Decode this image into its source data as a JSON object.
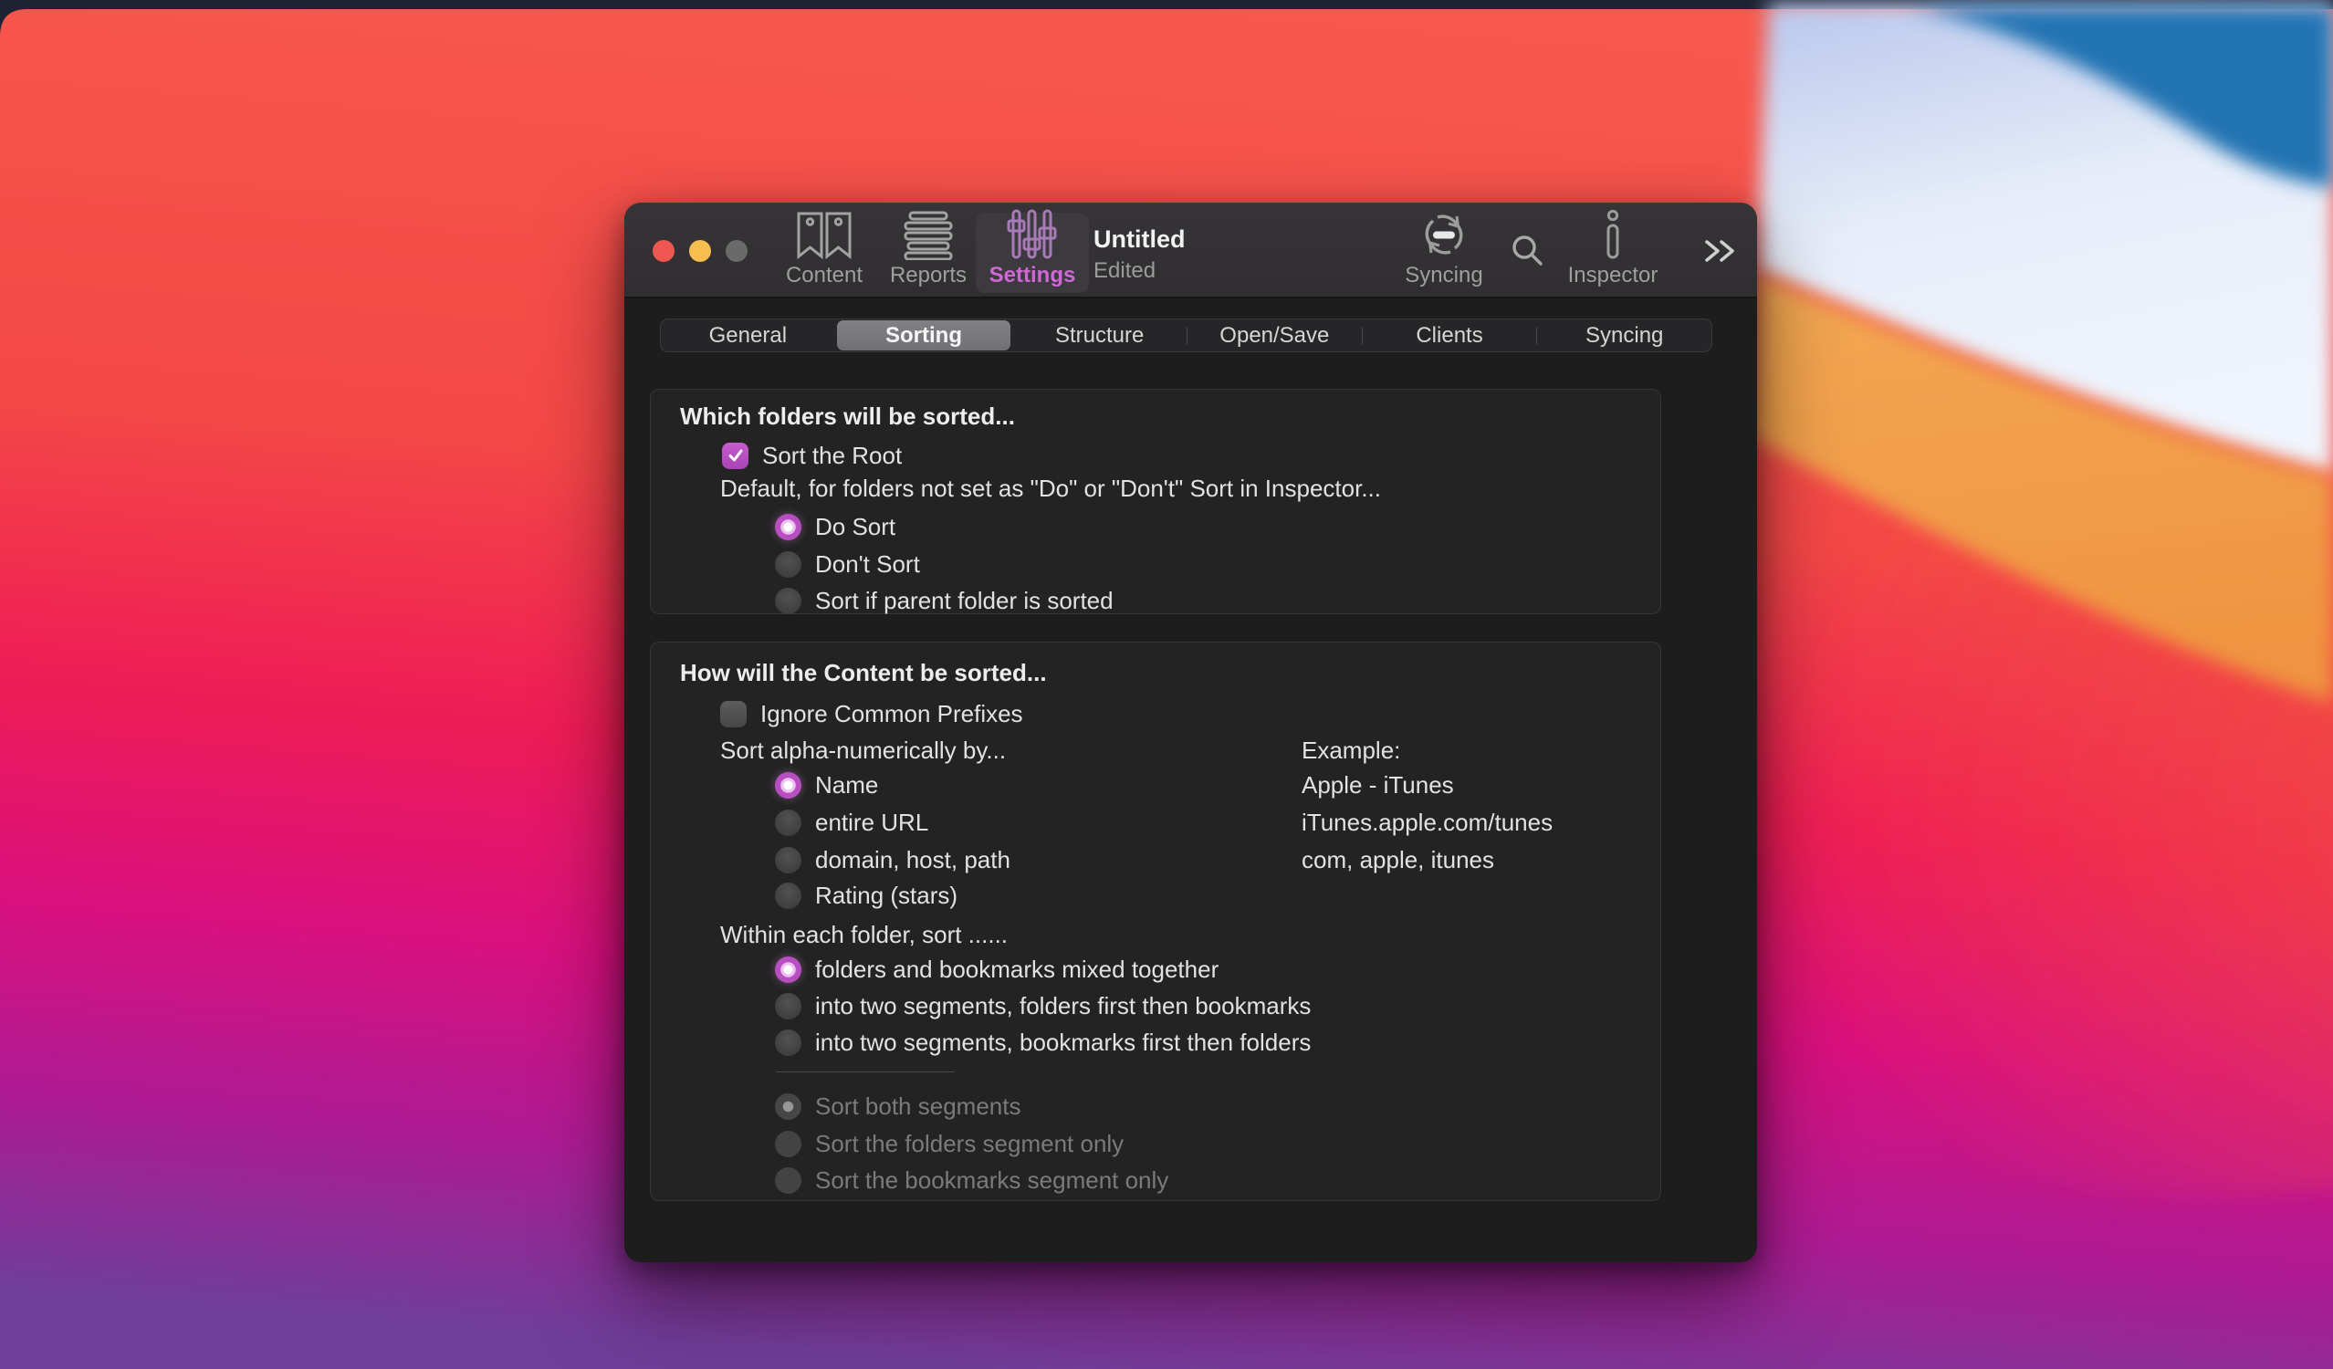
{
  "win": {
    "title": "Untitled",
    "edited": "Edited",
    "toolbar": {
      "content": "Content",
      "reports": "Reports",
      "settings": "Settings",
      "syncing": "Syncing",
      "inspector": "Inspector"
    },
    "tabs": [
      "General",
      "Sorting",
      "Structure",
      "Open/Save",
      "Clients",
      "Syncing"
    ],
    "selected_tab": "Sorting",
    "traffic_colors": {
      "close": "#f05750",
      "minimize": "#f6bd4f",
      "zoom_inactive": "#6a6a6a"
    },
    "accent": "#b74fc2"
  },
  "g1": {
    "heading": "Which folders will be sorted...",
    "sort_root": {
      "label": "Sort the Root",
      "checked": true
    },
    "default_line": "Default, for folders not set as \"Do\" or \"Don't\" Sort in Inspector...",
    "radios": [
      {
        "label": "Do Sort",
        "selected": true
      },
      {
        "label": "Don't Sort",
        "selected": false
      },
      {
        "label": "Sort if parent folder is sorted",
        "selected": false
      }
    ]
  },
  "g2": {
    "heading": "How will the Content be sorted...",
    "ignore_prefixes": {
      "label": "Ignore Common Prefixes",
      "checked": false
    },
    "sortby_label": "Sort alpha-numerically by...",
    "example_header": "Example:",
    "sortby": [
      {
        "label": "Name",
        "selected": true,
        "example": "Apple - iTunes"
      },
      {
        "label": "entire URL",
        "selected": false,
        "example": "iTunes.apple.com/tunes"
      },
      {
        "label": "domain, host, path",
        "selected": false,
        "example": "com, apple, itunes"
      },
      {
        "label": "Rating (stars)",
        "selected": false,
        "example": ""
      }
    ],
    "within_label": "Within each folder, sort ......",
    "within": [
      {
        "label": "folders and bookmarks mixed together",
        "selected": true
      },
      {
        "label": "into two segments, folders first then bookmarks",
        "selected": false
      },
      {
        "label": "into two segments, bookmarks first then folders",
        "selected": false
      }
    ],
    "segments": [
      {
        "label": "Sort both segments",
        "selected": true,
        "disabled": true
      },
      {
        "label": "Sort the folders segment only",
        "selected": false,
        "disabled": true
      },
      {
        "label": "Sort the bookmarks segment only",
        "selected": false,
        "disabled": true
      }
    ]
  }
}
